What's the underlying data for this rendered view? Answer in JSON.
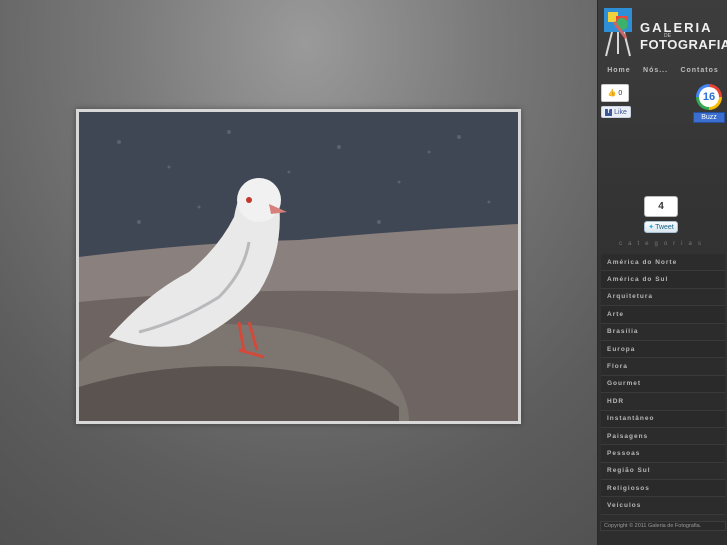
{
  "site": {
    "logo_line1": "GALERIA",
    "logo_line2": "DE",
    "logo_line3": "FOTOGRAFIA"
  },
  "nav": {
    "home": "Home",
    "nos": "Nós...",
    "contatos": "Contatos"
  },
  "social": {
    "facebook_count": "0",
    "facebook_label": "Like",
    "buzz_count": "16",
    "buzz_label": "Buzz",
    "tweet_count": "4",
    "tweet_label": "Tweet"
  },
  "categories_title": "categorias",
  "categories": [
    "América do Norte",
    "América do Sul",
    "Arquitetura",
    "Arte",
    "Brasília",
    "Europa",
    "Flora",
    "Gourmet",
    "HDR",
    "Instantâneo",
    "Paisagens",
    "Pessoas",
    "Região Sul",
    "Religiosos",
    "Veículos"
  ],
  "footer": {
    "copyright": "Copyright © 2011 Galeria de Fotografia."
  },
  "colors": {
    "sidebar_bg": "#333333",
    "category_bg": "#2a2a2a",
    "category_text": "#b8b8b8"
  },
  "icons": [
    "logo-easel-icon",
    "facebook-thumb-icon",
    "buzz-icon",
    "twitter-bird-icon"
  ]
}
